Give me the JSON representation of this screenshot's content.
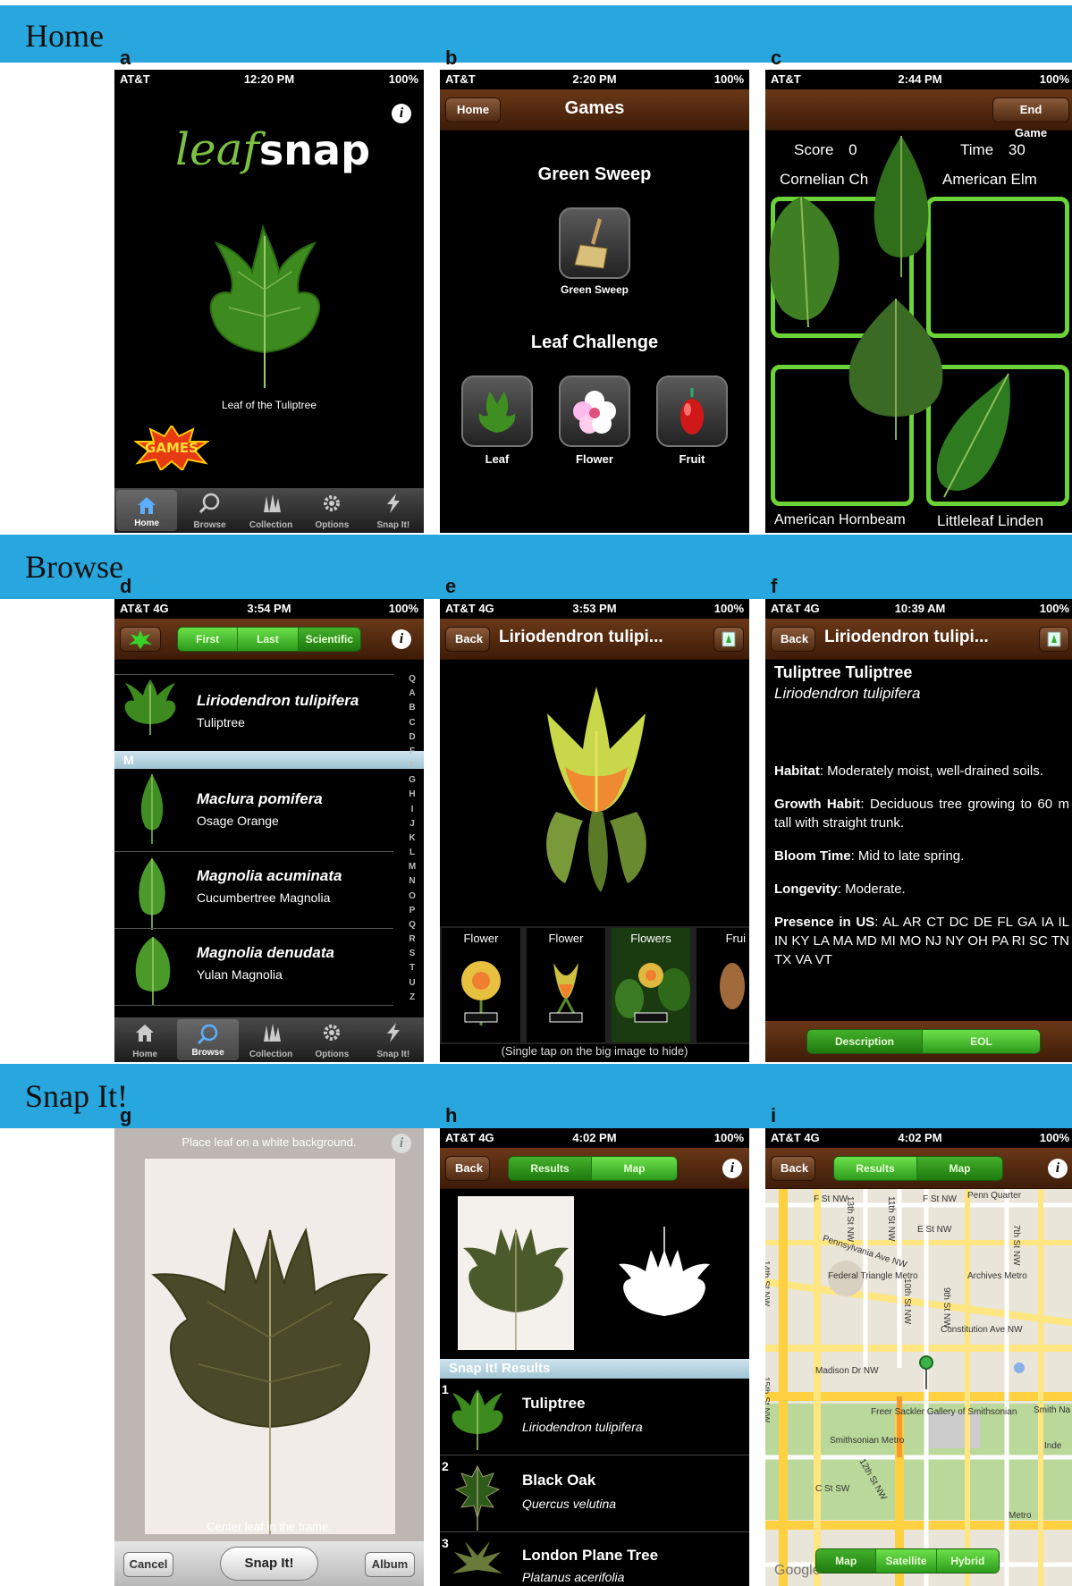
{
  "sections": {
    "home": "Home",
    "browse": "Browse",
    "snap": "Snap It!"
  },
  "panel_labels": [
    "a",
    "b",
    "c",
    "d",
    "e",
    "f",
    "g",
    "h",
    "i"
  ],
  "colors": {
    "band": "#28a7de",
    "nav_brown": "#5a2c0e",
    "seg_green": "#3cb224",
    "game_green": "#6bd238"
  },
  "a": {
    "status": {
      "carrier": "AT&T",
      "time": "12:20 PM",
      "battery": "100%"
    },
    "logo_leaf": "leaf",
    "logo_snap": "snap",
    "caption": "Leaf of the Tuliptree",
    "games_badge": "GAMES",
    "tabs": [
      "Home",
      "Browse",
      "Collection",
      "Options",
      "Snap It!"
    ]
  },
  "b": {
    "status": {
      "carrier": "AT&T",
      "time": "2:20 PM",
      "battery": "100%"
    },
    "back": "Home",
    "title": "Games",
    "section1": "Green Sweep",
    "sweep_label": "Green Sweep",
    "section2": "Leaf Challenge",
    "challenge": [
      "Leaf",
      "Flower",
      "Fruit"
    ]
  },
  "c": {
    "status": {
      "carrier": "AT&T",
      "time": "2:44 PM",
      "battery": "100%"
    },
    "end": "End Game",
    "score_label": "Score",
    "score": "0",
    "time_label": "Time",
    "time": "30",
    "targets": [
      "Cornelian Ch",
      "American Elm",
      "American Hornbeam",
      "Littleleaf Linden"
    ]
  },
  "d": {
    "status": {
      "carrier": "AT&T",
      "network": "4G",
      "time": "3:54 PM",
      "battery": "100%"
    },
    "seg": [
      "First",
      "Last",
      "Scientific"
    ],
    "section_m": "M",
    "rows": [
      {
        "sci": "Liriodendron tulipifera",
        "common": "Tuliptree"
      },
      {
        "sci": "Maclura pomifera",
        "common": "Osage Orange"
      },
      {
        "sci": "Magnolia acuminata",
        "common": "Cucumbertree Magnolia"
      },
      {
        "sci": "Magnolia denudata",
        "common": "Yulan Magnolia"
      }
    ],
    "index": [
      "Q",
      "A",
      "B",
      "C",
      "D",
      "F",
      "F",
      "G",
      "H",
      "I",
      "J",
      "K",
      "L",
      "M",
      "N",
      "O",
      "P",
      "Q",
      "R",
      "S",
      "T",
      "U",
      "Z"
    ],
    "tabs": [
      "Home",
      "Browse",
      "Collection",
      "Options",
      "Snap It!"
    ]
  },
  "e": {
    "status": {
      "carrier": "AT&T",
      "network": "4G",
      "time": "3:53 PM",
      "battery": "100%"
    },
    "back": "Back",
    "title": "Liriodendron tulipi...",
    "thumbs": [
      "Flower",
      "Flower",
      "Flowers",
      "Frui"
    ],
    "hint": "(Single tap on the big image to hide)"
  },
  "f": {
    "status": {
      "carrier": "AT&T",
      "network": "4G",
      "time": "10:39 AM",
      "battery": "100%"
    },
    "back": "Back",
    "title": "Liriodendron tulipi...",
    "common": "Tuliptree Tuliptree",
    "sci": "Liriodendron tulipifera",
    "facts": [
      {
        "k": "Habitat",
        "v": ": Moderately moist, well-drained soils."
      },
      {
        "k": "Growth Habit",
        "v": ": Deciduous tree growing to 60 m tall with straight trunk."
      },
      {
        "k": "Bloom Time",
        "v": ": Mid to late spring."
      },
      {
        "k": "Longevity",
        "v": ": Moderate."
      },
      {
        "k": "Presence in US",
        "v": ": AL AR CT DC DE FL GA IA IL IN KY LA MA MD MI MO NJ NY OH PA RI SC TN TX VA VT"
      }
    ],
    "seg": [
      "Description",
      "EOL"
    ]
  },
  "g": {
    "top_hint": "Place leaf on a white background.",
    "bottom_hint": "Center leaf in the frame.",
    "cancel": "Cancel",
    "snap": "Snap It!",
    "album": "Album"
  },
  "h": {
    "status": {
      "carrier": "AT&T",
      "network": "4G",
      "time": "4:02 PM",
      "battery": "100%"
    },
    "back": "Back",
    "seg": [
      "Results",
      "Map"
    ],
    "results_header": "Snap It! Results",
    "results": [
      {
        "n": "1",
        "common": "Tuliptree",
        "sci": "Liriodendron tulipifera"
      },
      {
        "n": "2",
        "common": "Black Oak",
        "sci": "Quercus velutina"
      },
      {
        "n": "3",
        "common": "London Plane Tree",
        "sci": "Platanus acerifolia"
      }
    ]
  },
  "i": {
    "status": {
      "carrier": "AT&T",
      "network": "4G",
      "time": "4:02 PM",
      "battery": "100%"
    },
    "back": "Back",
    "seg": [
      "Results",
      "Map"
    ],
    "map_labels": [
      "F St NW",
      "F St NW",
      "E St NW",
      "Penn Quarter",
      "Pennsylvania Ave NW",
      "Federal Triangle Metro",
      "Archives Metro",
      "Constitution Ave NW",
      "Madison Dr NW",
      "Freer Sackler Gallery of Smithsonian",
      "Smithsonian Metro",
      "C St SW",
      "14th St NW",
      "15th St NW",
      "12th St NW",
      "9th St NW",
      "7th St NW",
      "10th St NW",
      "11th St NW",
      "13th St NW",
      "Metro",
      "Smith Na Sp",
      "Inde",
      "Google"
    ],
    "map_seg": [
      "Map",
      "Satellite",
      "Hybrid"
    ]
  }
}
